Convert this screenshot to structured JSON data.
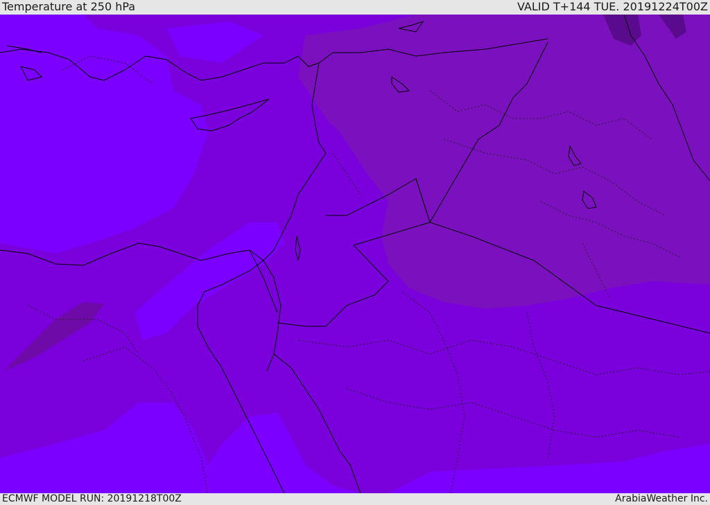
{
  "header": {
    "title": "Temperature at 250 hPa",
    "valid": "VALID T+144 TUE. 20191224T00Z"
  },
  "footer": {
    "model_run": "ECMWF MODEL RUN: 20191218T00Z",
    "credit": "ArabiaWeather Inc."
  },
  "colors": {
    "warmest_band": "#7c00ff",
    "warm_band": "#7a00dc",
    "mid_band": "#7b10be",
    "cool_band": "#6e0aa8",
    "coldest_band": "#5a0a8c",
    "coastline": "#000000",
    "border": "#000000"
  }
}
